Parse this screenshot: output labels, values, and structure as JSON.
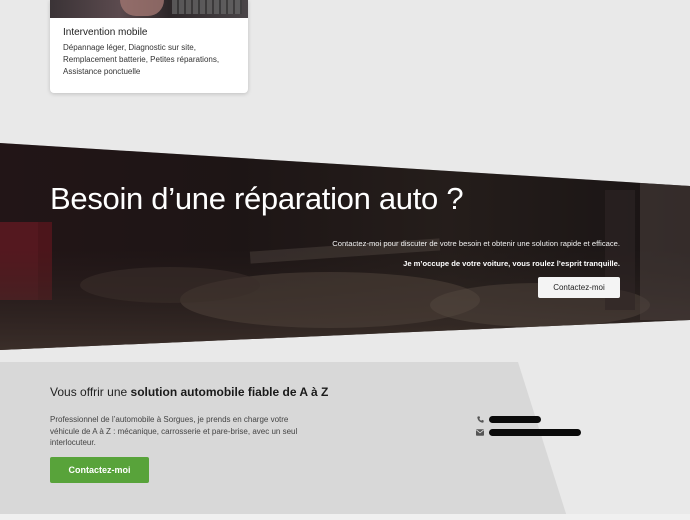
{
  "service_card": {
    "title": "Intervention mobile",
    "description": "Dépannage léger, Diagnostic sur site, Remplacement batterie, Petites réparations, Assistance ponctuelle"
  },
  "hero": {
    "title": "Besoin d’une réparation auto ?",
    "line1": "Contactez-moi pour discuter de votre besoin et obtenir une solution rapide et efficace.",
    "line2": "Je m’occupe de votre voiture, vous roulez l’esprit tranquille.",
    "button_label": "Contactez-moi"
  },
  "offer": {
    "title_prefix": "Vous offrir une",
    "title_bold": "solution automobile fiable de A à Z",
    "description": "Professionnel de l’automobile à Sorgues, je prends en charge votre véhicule de A à Z : mécanique, carrosserie et pare-brise, avec un seul interlocuteur.",
    "button_label": "Contactez-moi"
  },
  "contact": {
    "phone_icon": "phone-icon",
    "email_icon": "envelope-icon"
  },
  "colors": {
    "page_background": "#e9e9e9",
    "hero_overlay": "#1c1416",
    "offer_panel": "#d9d9d9",
    "green_button": "#58a33a"
  }
}
